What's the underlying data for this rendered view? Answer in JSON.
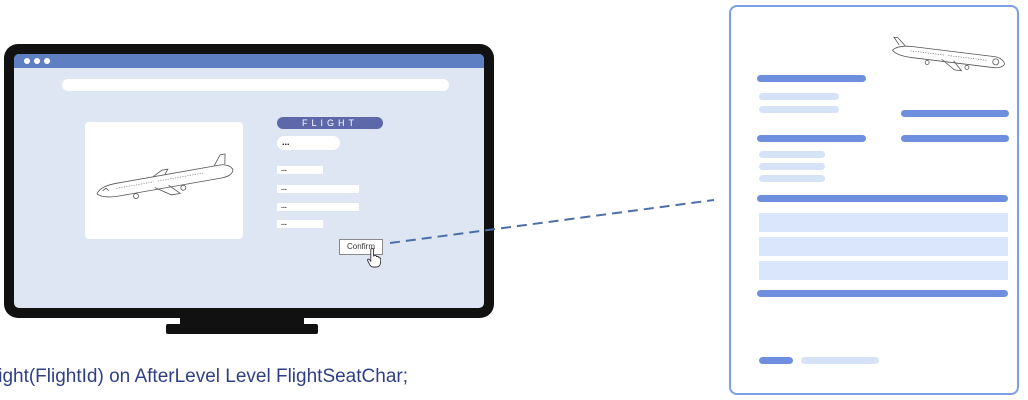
{
  "form": {
    "badge": "FLIGHT",
    "value_main": "...",
    "field_values": [
      "...",
      "...",
      "...",
      "..."
    ],
    "confirm_label": "Confirm"
  },
  "code_line": "light(FlightId) on AfterLevel Level FlightSeatChar;",
  "colors": {
    "titlebar": "#5e7fc2",
    "screen": "#dde6f2",
    "badge": "#5d68aa",
    "accent_bar": "#6e8fe0",
    "light_bar": "#d6e3f6",
    "code_text": "#2f3f86"
  },
  "icons": [
    "airplane-icon",
    "hand-pointer-icon"
  ]
}
